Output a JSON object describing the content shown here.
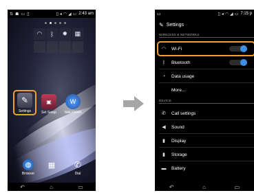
{
  "home": {
    "status_time": "2:43 am",
    "apps": {
      "settings": "Settings",
      "setup": "Set Setup",
      "walkman": "WALKMAN"
    },
    "dock": {
      "browser": "Browser",
      "dial": "Dial"
    }
  },
  "settings": {
    "status_time": "7:15 p",
    "title": "Settings",
    "section_wireless": "WIRELESS & NETWORKS",
    "section_device": "DEVICE",
    "items": {
      "wifi": "Wi-Fi",
      "bluetooth": "Bluetooth",
      "data_usage": "Data usage",
      "more": "More...",
      "call_settings": "Call settings",
      "sound": "Sound",
      "display": "Display",
      "storage": "Storage",
      "battery": "Battery"
    },
    "wifi_on": true,
    "bluetooth_on": true
  },
  "colors": {
    "highlight": "#f0a32a",
    "toggle_on": "#3d8fe6",
    "arrow": "#a6a6a6"
  }
}
